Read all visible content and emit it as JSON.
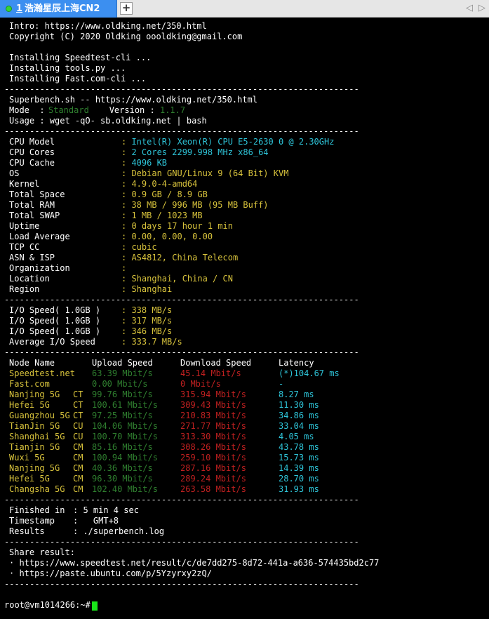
{
  "colors": {
    "tab_bg": "#3c8ff0",
    "white": "#ffffff",
    "cyan": "#2ec4d8",
    "yellow": "#d8c33c",
    "green": "#2f7f2f",
    "red": "#c02020",
    "light_green": "#2ec12e",
    "cursor": "#19e619"
  },
  "tab": {
    "number": "1",
    "title": "浩瀚星辰上海CN2",
    "status_icon": "green-circle-icon"
  },
  "toolbar": {
    "add_tab": "+",
    "prev": "◁",
    "next": "▷"
  },
  "terminal": {
    "divider": "----------------------------------------------------------------------",
    "intro": "Intro: https://www.oldking.net/350.html",
    "copyright": "Copyright (C) 2020 Oldking oooldking@gmail.com",
    "installing": [
      "Installing Speedtest-cli ...",
      "Installing tools.py ...",
      "Installing Fast.com-cli ..."
    ],
    "banner": {
      "line": "Superbench.sh -- https://www.oldking.net/350.html",
      "mode_label": "Mode  :",
      "mode_value": "Standard",
      "version_label": "Version :",
      "version_value": "1.1.7",
      "usage": "Usage : wget -qO- sb.oldking.net | bash"
    },
    "sysinfo": [
      {
        "label": "CPU Model",
        "value": "Intel(R) Xeon(R) CPU E5-2630 0 @ 2.30GHz",
        "color": "#2ec4d8"
      },
      {
        "label": "CPU Cores",
        "value": "2 Cores 2299.998 MHz x86_64",
        "color": "#2ec4d8"
      },
      {
        "label": "CPU Cache",
        "value": "4096 KB",
        "color": "#2ec4d8"
      },
      {
        "label": "OS",
        "value": "Debian GNU/Linux 9 (64 Bit) KVM",
        "color": "#d8c33c"
      },
      {
        "label": "Kernel",
        "value": "4.9.0-4-amd64",
        "color": "#d8c33c"
      },
      {
        "label": "Total Space",
        "value": "0.9 GB / 8.9 GB",
        "color": "#d8c33c"
      },
      {
        "label": "Total RAM",
        "value": "38 MB / 996 MB (95 MB Buff)",
        "color": "#d8c33c"
      },
      {
        "label": "Total SWAP",
        "value": "1 MB / 1023 MB",
        "color": "#d8c33c"
      },
      {
        "label": "Uptime",
        "value": "0 days 17 hour 1 min",
        "color": "#d8c33c"
      },
      {
        "label": "Load Average",
        "value": "0.00, 0.00, 0.00",
        "color": "#d8c33c"
      },
      {
        "label": "TCP CC",
        "value": "cubic",
        "color": "#d8c33c"
      },
      {
        "label": "ASN & ISP",
        "value": "AS4812, China Telecom",
        "color": "#d8c33c"
      },
      {
        "label": "Organization",
        "value": "",
        "color": "#d8c33c"
      },
      {
        "label": "Location",
        "value": "Shanghai, China / CN",
        "color": "#d8c33c"
      },
      {
        "label": "Region",
        "value": "Shanghai",
        "color": "#d8c33c"
      }
    ],
    "io": [
      {
        "label": "I/O Speed( 1.0GB )",
        "value": "338 MB/s"
      },
      {
        "label": "I/O Speed( 1.0GB )",
        "value": "317 MB/s"
      },
      {
        "label": "I/O Speed( 1.0GB )",
        "value": "346 MB/s"
      },
      {
        "label": "Average I/O Speed",
        "value": "333.7 MB/s"
      }
    ],
    "speed_header": {
      "node": "Node Name",
      "upload": "Upload Speed",
      "download": "Download Speed",
      "latency": "Latency"
    },
    "speed_rows": [
      {
        "node": "Speedtest.net",
        "isp": "",
        "upload": "63.39 Mbit/s",
        "download": "45.14 Mbit/s",
        "latency": "(*)104.67 ms",
        "node_color": "#d8c33c"
      },
      {
        "node": "Fast.com",
        "isp": "",
        "upload": "0.00 Mbit/s",
        "download": "0 Mbit/s",
        "latency": "-",
        "node_color": "#d8c33c"
      },
      {
        "node": "Nanjing 5G",
        "isp": "CT",
        "upload": "99.76 Mbit/s",
        "download": "315.94 Mbit/s",
        "latency": "8.27 ms",
        "node_color": "#d8c33c"
      },
      {
        "node": "Hefei 5G",
        "isp": "CT",
        "upload": "100.61 Mbit/s",
        "download": "309.43 Mbit/s",
        "latency": "11.30 ms",
        "node_color": "#d8c33c"
      },
      {
        "node": "Guangzhou 5G",
        "isp": "CT",
        "upload": "97.25 Mbit/s",
        "download": "210.83 Mbit/s",
        "latency": "34.86 ms",
        "node_color": "#d8c33c"
      },
      {
        "node": "TianJin 5G",
        "isp": "CU",
        "upload": "104.06 Mbit/s",
        "download": "271.77 Mbit/s",
        "latency": "33.04 ms",
        "node_color": "#d8c33c"
      },
      {
        "node": "Shanghai 5G",
        "isp": "CU",
        "upload": "100.70 Mbit/s",
        "download": "313.30 Mbit/s",
        "latency": "4.05 ms",
        "node_color": "#d8c33c"
      },
      {
        "node": "Tianjin 5G",
        "isp": "CM",
        "upload": "85.16 Mbit/s",
        "download": "308.26 Mbit/s",
        "latency": "43.78 ms",
        "node_color": "#d8c33c"
      },
      {
        "node": "Wuxi 5G",
        "isp": "CM",
        "upload": "100.94 Mbit/s",
        "download": "259.10 Mbit/s",
        "latency": "15.73 ms",
        "node_color": "#d8c33c"
      },
      {
        "node": "Nanjing 5G",
        "isp": "CM",
        "upload": "40.36 Mbit/s",
        "download": "287.16 Mbit/s",
        "latency": "14.39 ms",
        "node_color": "#d8c33c"
      },
      {
        "node": "Hefei 5G",
        "isp": "CM",
        "upload": "96.30 Mbit/s",
        "download": "289.24 Mbit/s",
        "latency": "28.70 ms",
        "node_color": "#d8c33c"
      },
      {
        "node": "Changsha 5G",
        "isp": "CM",
        "upload": "102.40 Mbit/s",
        "download": "263.58 Mbit/s",
        "latency": "31.93 ms",
        "node_color": "#d8c33c"
      }
    ],
    "finished": [
      {
        "label": "Finished in",
        "value": ": 5 min 4 sec"
      },
      {
        "label": "Timestamp",
        "value": ":   GMT+8"
      },
      {
        "label": "Results",
        "value": ": ./superbench.log"
      }
    ],
    "share_title": "Share result:",
    "share_links": [
      "· https://www.speedtest.net/result/c/de7dd275-8d72-441a-a636-574435bd2c77",
      "· https://paste.ubuntu.com/p/5Yzyrxy2zQ/"
    ],
    "prompt": "root@vm1014266:~#"
  }
}
